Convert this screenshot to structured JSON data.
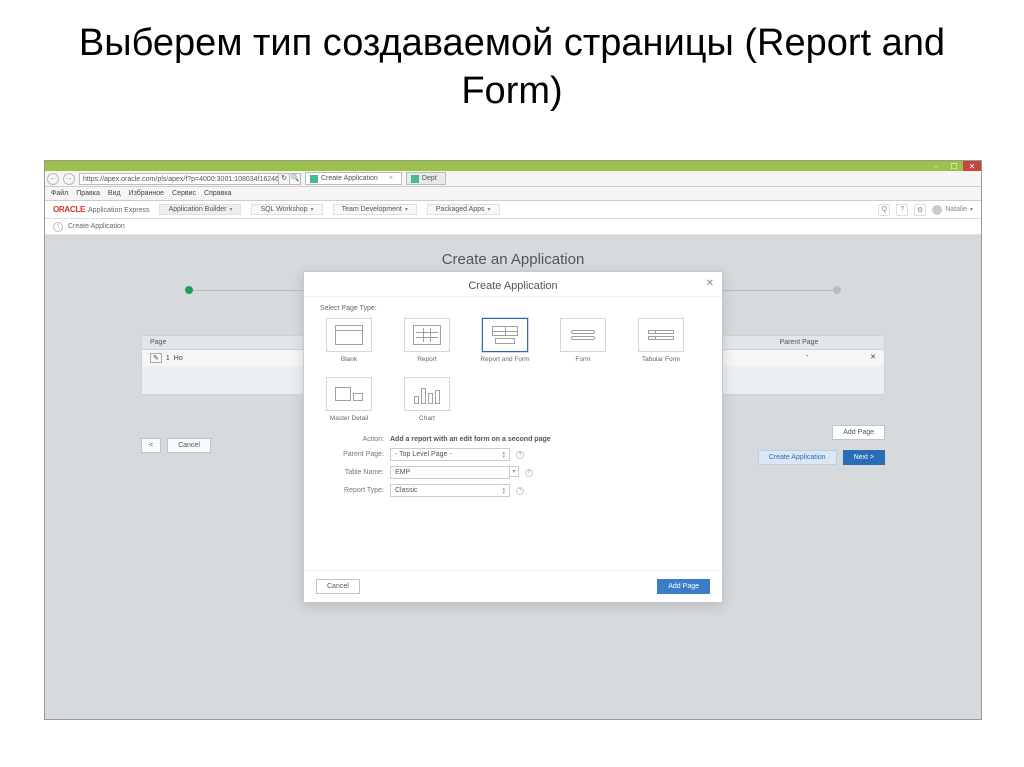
{
  "slide": {
    "title": "Выберем тип создаваемой страницы (Report and Form)"
  },
  "browser": {
    "url": "https://apex.oracle.com/pls/apex/f?p=4000:3001:108034f16246825::NO::",
    "tabs": [
      {
        "label": "Create Application",
        "active": true
      },
      {
        "label": "Dept",
        "active": false
      }
    ],
    "menu": [
      "Файл",
      "Правка",
      "Вид",
      "Избранное",
      "Сервис",
      "Справка"
    ],
    "window_buttons": {
      "min": "–",
      "max": "☐",
      "close": "✕"
    }
  },
  "app": {
    "brand": {
      "oracle": "ORACLE",
      "suffix": "Application Express"
    },
    "nav": [
      {
        "label": "Application Builder",
        "active": true
      },
      {
        "label": "SQL Workshop"
      },
      {
        "label": "Team Development"
      },
      {
        "label": "Packaged Apps"
      }
    ],
    "user": "Natalie",
    "breadcrumb": "Create Application"
  },
  "wizard": {
    "title": "Create an Application",
    "bg_columns": {
      "page": "Page",
      "parent": "Parent Page"
    },
    "bg_row": {
      "num": "1",
      "name": "Ho"
    },
    "buttons": {
      "back": "<",
      "cancel": "Cancel",
      "add_page_bg": "Add Page",
      "create_app": "Create Application",
      "next": "Next >"
    }
  },
  "modal": {
    "title": "Create Application",
    "section_label": "Select Page Type:",
    "types": [
      {
        "key": "blank",
        "label": "Blank"
      },
      {
        "key": "report",
        "label": "Report"
      },
      {
        "key": "report_form",
        "label": "Report and Form",
        "selected": true
      },
      {
        "key": "form",
        "label": "Form"
      },
      {
        "key": "tabular",
        "label": "Tabular Form"
      },
      {
        "key": "master_detail",
        "label": "Master Detail"
      },
      {
        "key": "chart",
        "label": "Chart"
      }
    ],
    "form": {
      "action_label": "Action:",
      "action_value": "Add a report with an edit form on a second page",
      "parent_label": "Parent Page:",
      "parent_value": "- Top Level Page -",
      "table_label": "Table Name:",
      "table_value": "EMP",
      "rtype_label": "Report Type:",
      "rtype_value": "Classic"
    },
    "buttons": {
      "cancel": "Cancel",
      "add_page": "Add Page"
    }
  }
}
